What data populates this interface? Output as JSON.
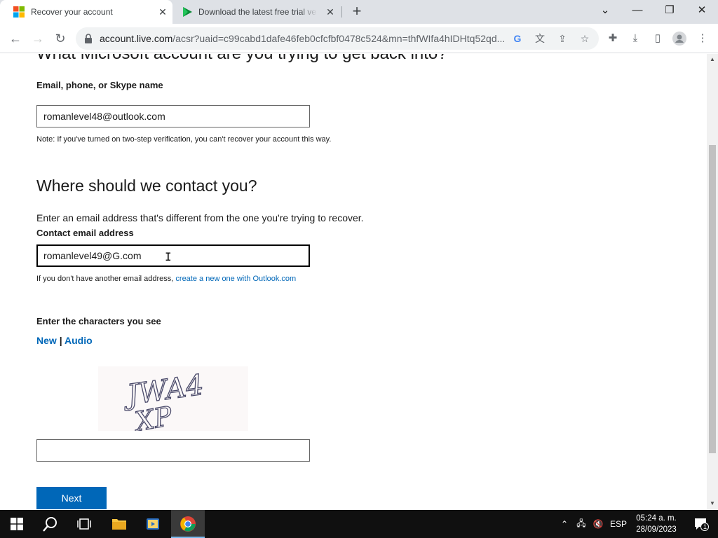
{
  "browser": {
    "tabs": [
      {
        "title": "Recover your account",
        "active": true,
        "favicon": "microsoft-logo-icon"
      },
      {
        "title": "Download the latest free trial ve",
        "active": false,
        "favicon": "play-store-icon"
      }
    ],
    "address": {
      "host": "account.live.com",
      "path": "/acsr?uaid=c99cabd1dafe46feb0cfcfbf0478c524&mn=thfWIfa4hIDHtq52qd..."
    },
    "window_controls": [
      "minimize",
      "maximize",
      "close"
    ]
  },
  "page": {
    "cut_heading": "What Microsoft account are you trying to get back into?",
    "account_field": {
      "label": "Email, phone, or Skype name",
      "value": "romanlevel48@outlook.com"
    },
    "note": "Note: If you've turned on two-step verification, you can't recover your account this way.",
    "contact_heading": "Where should we contact you?",
    "contact_intro": "Enter an email address that's different from the one you're trying to recover.",
    "contact_field": {
      "label": "Contact email address",
      "value": "romanlevel49@G.com"
    },
    "no_email_text": "If you don't have another email address,",
    "no_email_link": "create a new one with Outlook.com",
    "captcha_label": "Enter the characters you see",
    "captcha_new": "New",
    "captcha_sep": "|",
    "captcha_audio": "Audio",
    "captcha_text": "JWA4XP",
    "captcha_input_value": "",
    "next_button": "Next"
  },
  "taskbar": {
    "language": "ESP",
    "time": "05:24 a. m.",
    "date": "28/09/2023",
    "notification_count": "1"
  },
  "colors": {
    "link": "#0067b8",
    "primary_button": "#0067b8",
    "taskbar": "#101010"
  }
}
